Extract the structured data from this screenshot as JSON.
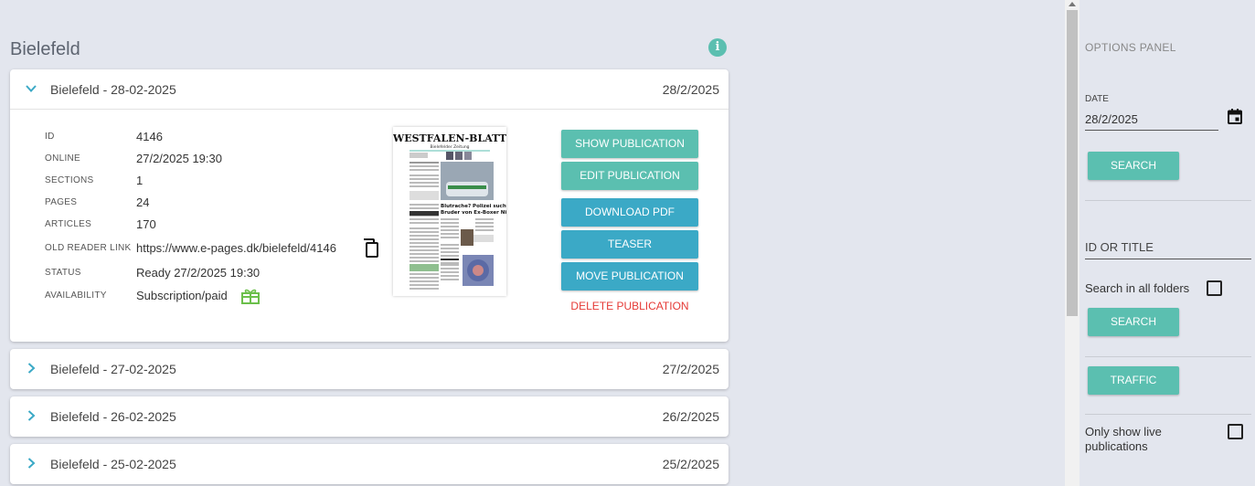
{
  "page": {
    "title": "Bielefeld"
  },
  "colors": {
    "teal": "#5bbfb0",
    "blue": "#3ba9c6",
    "danger": "#e53935",
    "background": "#e3e6ee"
  },
  "expanded_publication": {
    "title": "Bielefeld - 28-02-2025",
    "date": "28/2/2025",
    "details": [
      {
        "label": "ID",
        "value": "4146"
      },
      {
        "label": "ONLINE",
        "value": "27/2/2025 19:30"
      },
      {
        "label": "SECTIONS",
        "value": "1"
      },
      {
        "label": "PAGES",
        "value": "24"
      },
      {
        "label": "ARTICLES",
        "value": "170"
      },
      {
        "label": "OLD READER LINK",
        "value": "https://www.e-pages.dk/bielefeld/4146"
      },
      {
        "label": "STATUS",
        "value": "Ready 27/2/2025 19:30"
      },
      {
        "label": "AVAILABILITY",
        "value": "Subscription/paid"
      }
    ],
    "thumbnail": {
      "masthead": "WESTFALEN-BLATT",
      "subtitle": "Bielefelder Zeitung",
      "headline": "Blutrache? Polizei sucht Bruder von Ex-Boxer Nimani"
    },
    "actions": {
      "show": "SHOW PUBLICATION",
      "edit": "EDIT PUBLICATION",
      "download": "DOWNLOAD PDF",
      "teaser": "TEASER",
      "move": "MOVE PUBLICATION",
      "delete": "DELETE PUBLICATION"
    }
  },
  "publications": [
    {
      "title": "Bielefeld - 27-02-2025",
      "date": "27/2/2025"
    },
    {
      "title": "Bielefeld - 26-02-2025",
      "date": "26/2/2025"
    },
    {
      "title": "Bielefeld - 25-02-2025",
      "date": "25/2/2025"
    }
  ],
  "options_panel": {
    "heading": "OPTIONS PANEL",
    "date_label": "DATE",
    "date_value": "28/2/2025",
    "search_label": "SEARCH",
    "id_title_placeholder": "ID OR TITLE",
    "search_all_folders_label": "Search in all folders",
    "search_all_folders_checked": false,
    "search2_label": "SEARCH",
    "traffic_label": "TRAFFIC",
    "only_live_label": "Only show live publications",
    "only_live_checked": false
  }
}
